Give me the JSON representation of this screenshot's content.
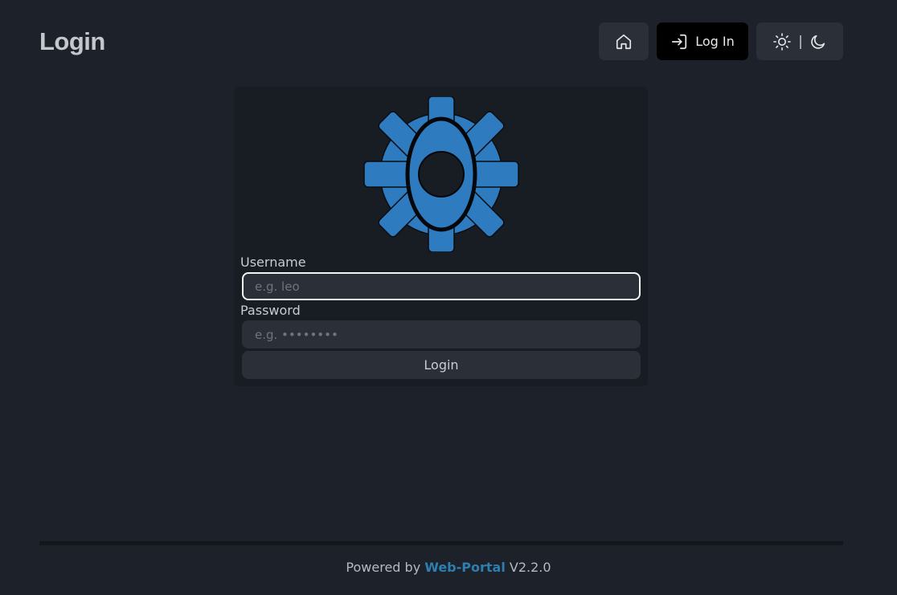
{
  "header": {
    "title": "Login",
    "nav": {
      "home_icon": "home-icon",
      "login_label": "Log In",
      "login_icon": "log-in-icon",
      "theme_light_icon": "sun-icon",
      "theme_separator": "|",
      "theme_dark_icon": "moon-icon"
    }
  },
  "login_form": {
    "logo_icon": "gear-eye-logo",
    "username_label": "Username",
    "username_placeholder": "e.g. leo",
    "username_value": "",
    "password_label": "Password",
    "password_placeholder": "e.g. ••••••••",
    "password_value": "",
    "submit_label": "Login"
  },
  "footer": {
    "prefix": "Powered by",
    "link_text": "Web-Portal",
    "version": "V2.2.0"
  },
  "colors": {
    "background": "#1d2129",
    "card": "#181c23",
    "button": "#2a2f38",
    "active_button": "#000000",
    "accent_link": "#2e7fb0",
    "logo_blue": "#2f7bbf"
  }
}
